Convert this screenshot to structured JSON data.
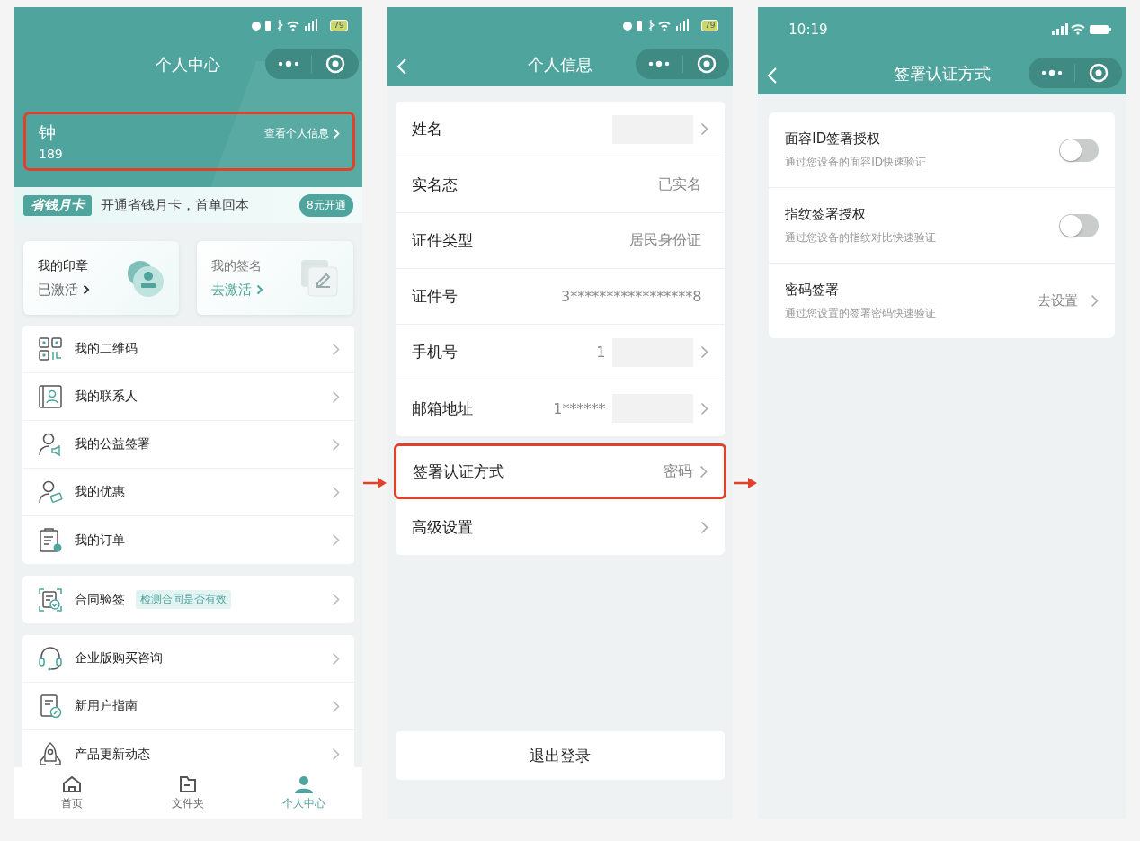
{
  "personal_center": {
    "status_bar": {
      "battery": "79"
    },
    "nav": {
      "title": "个人中心"
    },
    "user_card": {
      "name": "钟",
      "link": "查看个人信息",
      "phone": "189",
      "highlighted": true
    },
    "promo": {
      "badge": "省钱月卡",
      "text": "开通省钱月卡，首单回本",
      "button": "8元开通"
    },
    "quick_cards": [
      {
        "title": "我的印章",
        "status": "已激活",
        "active": true
      },
      {
        "title": "我的签名",
        "status": "去激活",
        "active": false
      }
    ],
    "menu_groups": [
      [
        {
          "label": "我的二维码"
        },
        {
          "label": "我的联系人"
        },
        {
          "label": "我的公益签署"
        },
        {
          "label": "我的优惠"
        },
        {
          "label": "我的订单"
        }
      ],
      [
        {
          "label": "合同验签",
          "tag": "检测合同是否有效"
        }
      ],
      [
        {
          "label": "企业版购买咨询"
        },
        {
          "label": "新用户指南"
        },
        {
          "label": "产品更新动态"
        }
      ]
    ],
    "tab_bar": [
      {
        "label": "首页",
        "selected": false
      },
      {
        "label": "文件夹",
        "selected": false
      },
      {
        "label": "个人中心",
        "selected": true
      }
    ]
  },
  "personal_info": {
    "status_bar": {
      "battery": "79"
    },
    "nav": {
      "title": "个人信息"
    },
    "groups": [
      [
        {
          "label": "姓名",
          "redacted": true,
          "chevron": true,
          "highlighted": false
        },
        {
          "label": "实名态",
          "value": "已实名",
          "redacted": false,
          "chevron": false,
          "highlighted": false
        },
        {
          "label": "证件类型",
          "value": "居民身份证",
          "redacted": false,
          "chevron": false,
          "highlighted": false
        },
        {
          "label": "证件号",
          "value": "3*****************8",
          "redacted": false,
          "chevron": false,
          "highlighted": false
        },
        {
          "label": "手机号",
          "value": "1",
          "redacted": true,
          "chevron": true,
          "highlighted": false
        },
        {
          "label": "邮箱地址",
          "value": "1******",
          "redacted": true,
          "chevron": true,
          "highlighted": false
        }
      ],
      [
        {
          "label": "签署认证方式",
          "value": "密码",
          "redacted": false,
          "chevron": true,
          "highlighted": true
        },
        {
          "label": "高级设置",
          "redacted": false,
          "chevron": true,
          "highlighted": false
        }
      ]
    ],
    "logout_button": "退出登录"
  },
  "auth_methods": {
    "status_bar": {
      "time": "10:19"
    },
    "nav": {
      "title": "签署认证方式"
    },
    "settings": [
      {
        "kind": "toggle",
        "title": "面容ID签署授权",
        "description": "通过您设备的面容ID快速验证",
        "on": false
      },
      {
        "kind": "toggle",
        "title": "指纹签署授权",
        "description": "通过您设备的指纹对比快速验证",
        "on": false
      },
      {
        "kind": "link",
        "title": "密码签署",
        "description": "通过您设置的签署密码快速验证",
        "value": "去设置"
      }
    ]
  }
}
